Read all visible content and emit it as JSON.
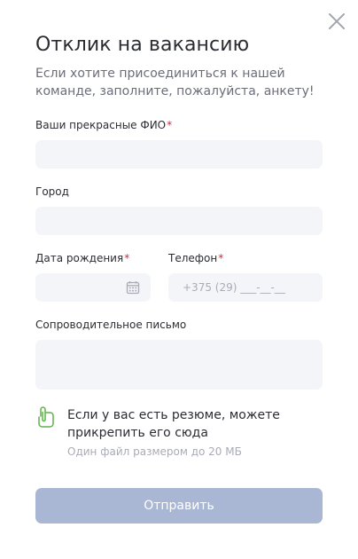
{
  "modal": {
    "close_icon": "close-icon",
    "title": "Отклик на вакансию",
    "subtitle": "Если хотите присоединиться к нашей команде, заполните, пожалуйста, анкету!"
  },
  "form": {
    "full_name": {
      "label": "Ваши прекрасные ФИО",
      "required_mark": "*",
      "value": ""
    },
    "city": {
      "label": "Город",
      "value": ""
    },
    "birth_date": {
      "label": "Дата рождения",
      "required_mark": "*",
      "value": "",
      "icon": "calendar-icon"
    },
    "phone": {
      "label": "Телефон",
      "required_mark": "*",
      "placeholder": "+375 (29) ___-__-__",
      "value": ""
    },
    "cover_letter": {
      "label": "Сопроводительное письмо",
      "value": ""
    },
    "attachment": {
      "icon": "paperclip-icon",
      "text": "Если у вас есть резюме, можете прикрепить его сюда",
      "hint": "Один файл размером до 20 МБ"
    },
    "submit_label": "Отправить"
  },
  "colors": {
    "field_bg": "#f4f5f9",
    "required": "#e0243b",
    "attach_icon": "#5fb24a",
    "submit_bg": "#a9b7d4"
  }
}
